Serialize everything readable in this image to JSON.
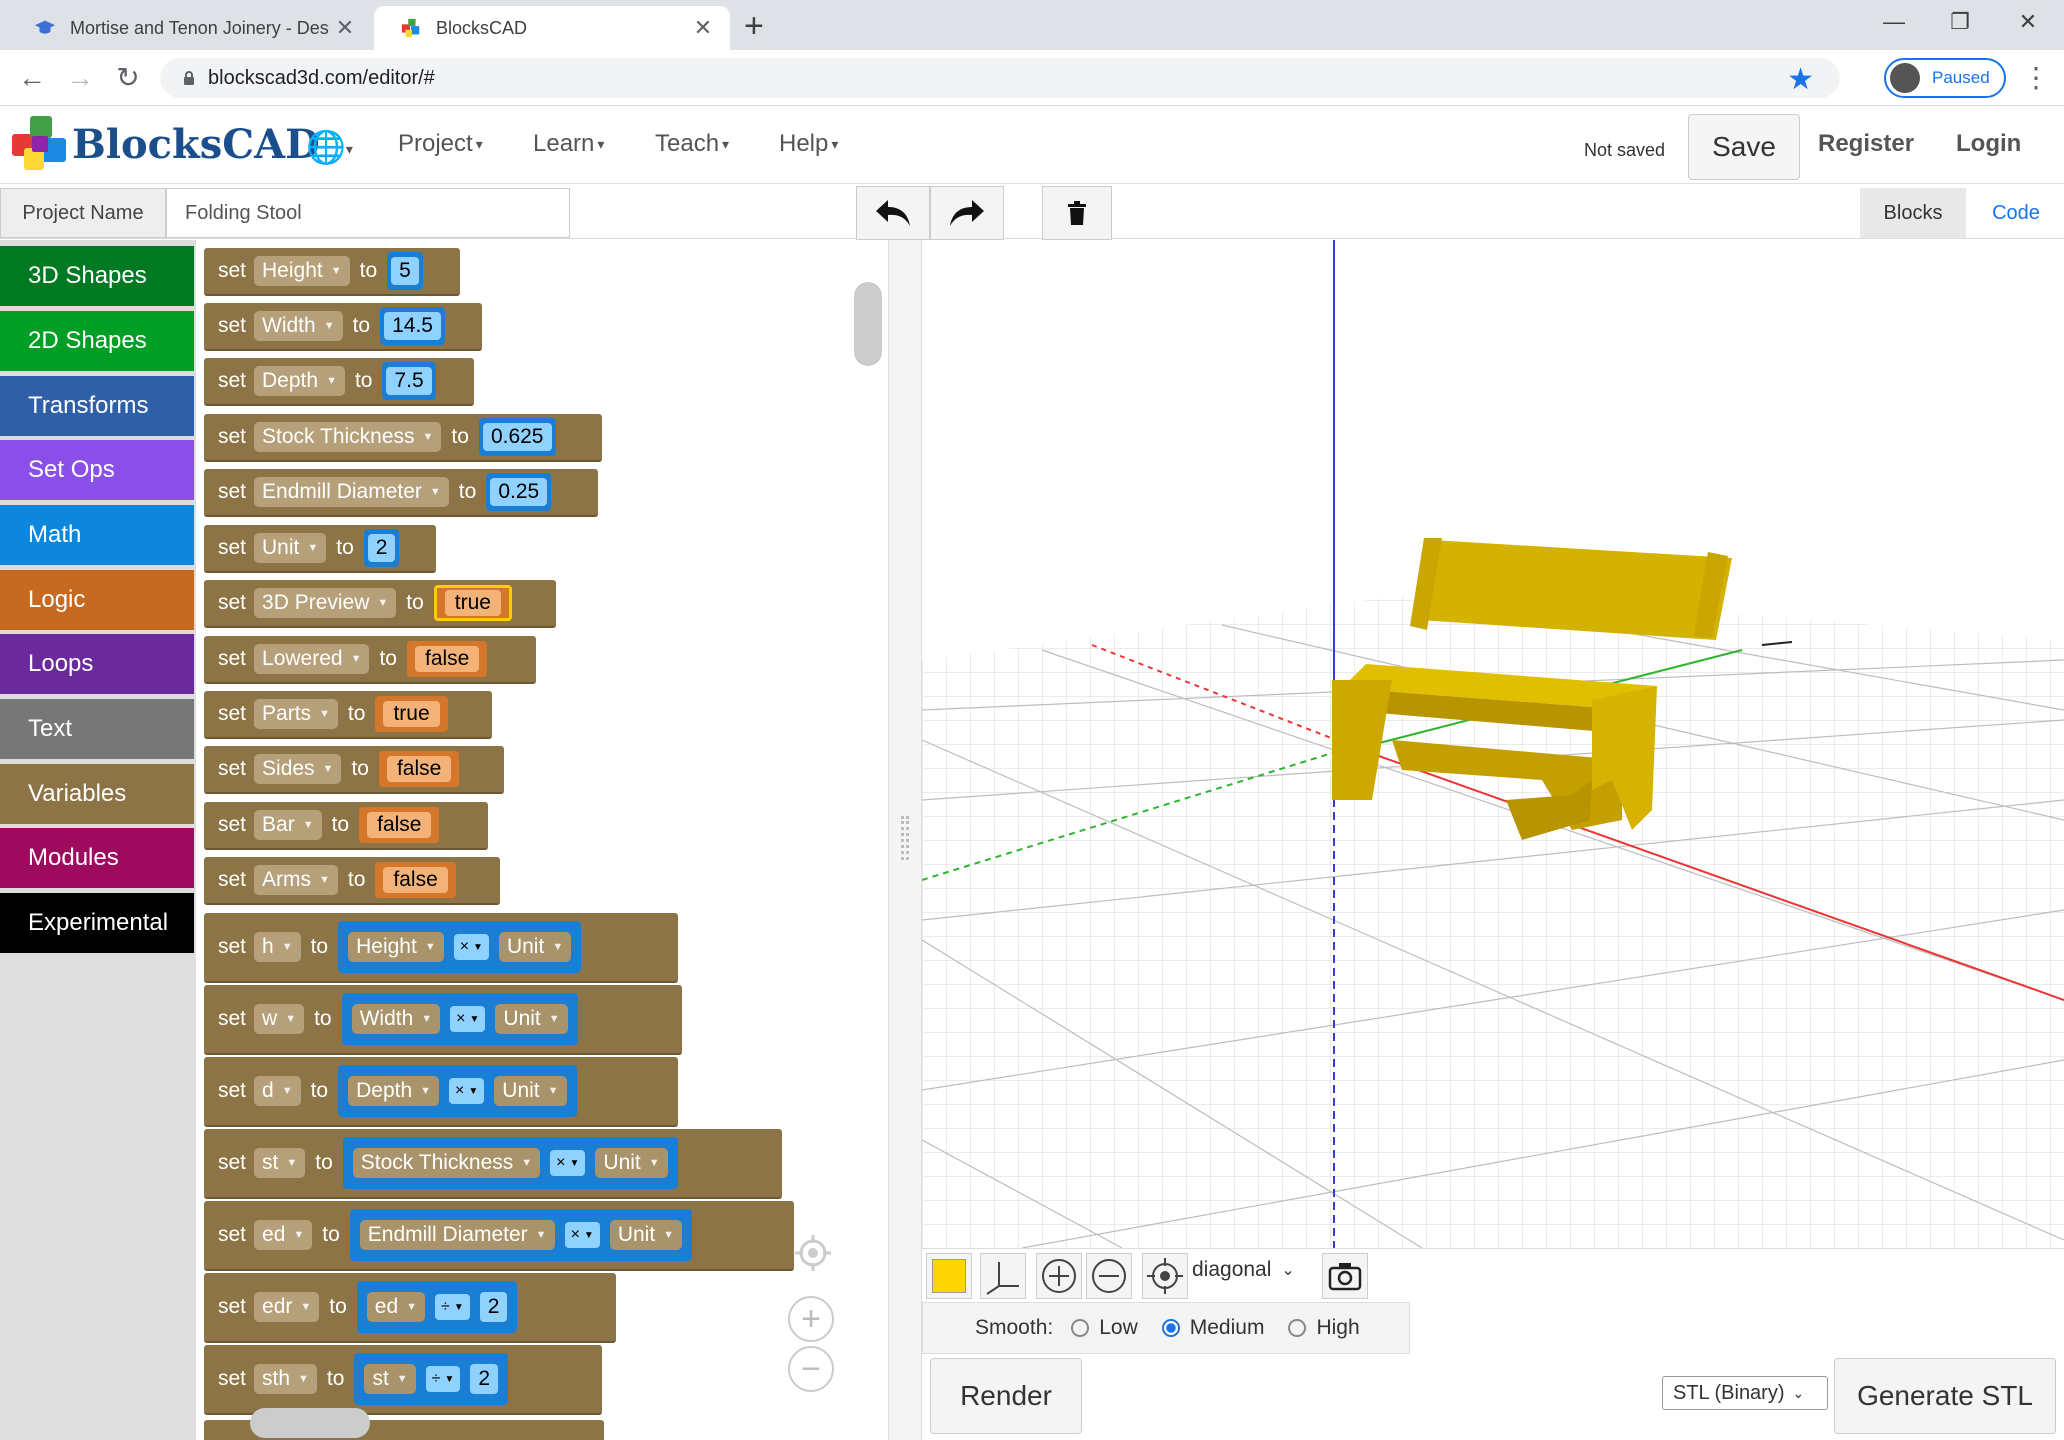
{
  "browser": {
    "tabs": [
      {
        "title": "Mortise and Tenon Joinery - Desi"
      },
      {
        "title": "BlocksCAD"
      }
    ],
    "url": "blockscad3d.com/editor/#",
    "profile_label": "Paused"
  },
  "app": {
    "logo": "BlocksCAD",
    "menu": [
      {
        "label": "Project"
      },
      {
        "label": "Learn"
      },
      {
        "label": "Teach"
      },
      {
        "label": "Help"
      }
    ],
    "status": "Not saved",
    "save_label": "Save",
    "register_label": "Register",
    "login_label": "Login",
    "project_name_label": "Project Name",
    "project_name_value": "Folding Stool",
    "view_tabs": {
      "blocks": "Blocks",
      "code": "Code"
    }
  },
  "categories": [
    {
      "label": "3D Shapes",
      "color": "#007a22"
    },
    {
      "label": "2D Shapes",
      "color": "#009e25"
    },
    {
      "label": "Transforms",
      "color": "#2f5fa7"
    },
    {
      "label": "Set Ops",
      "color": "#8a4fe8"
    },
    {
      "label": "Math",
      "color": "#0d87dc"
    },
    {
      "label": "Logic",
      "color": "#c66a22"
    },
    {
      "label": "Loops",
      "color": "#6a2a9c"
    },
    {
      "label": "Text",
      "color": "#777777"
    },
    {
      "label": "Variables",
      "color": "#8c7446"
    },
    {
      "label": "Modules",
      "color": "#9e0a5e"
    },
    {
      "label": "Experimental",
      "color": "#000000"
    }
  ],
  "blocks": {
    "set_kw": "set",
    "to_kw": "to",
    "times_op": "×",
    "divide_op": "÷",
    "simple": [
      {
        "var": "Height",
        "value": "5"
      },
      {
        "var": "Width",
        "value": "14.5"
      },
      {
        "var": "Depth",
        "value": "7.5"
      },
      {
        "var": "Stock Thickness",
        "value": "0.625"
      },
      {
        "var": "Endmill Diameter",
        "value": "0.25"
      },
      {
        "var": "Unit",
        "value": "2"
      }
    ],
    "booleans": [
      {
        "var": "3D Preview",
        "value": "true"
      },
      {
        "var": "Lowered",
        "value": "false"
      },
      {
        "var": "Parts",
        "value": "true"
      },
      {
        "var": "Sides",
        "value": "false"
      },
      {
        "var": "Bar",
        "value": "false"
      },
      {
        "var": "Arms",
        "value": "false"
      }
    ],
    "math": [
      {
        "var": "h",
        "a": "Height",
        "b": "Unit"
      },
      {
        "var": "w",
        "a": "Width",
        "b": "Unit"
      },
      {
        "var": "d",
        "a": "Depth",
        "b": "Unit"
      },
      {
        "var": "st",
        "a": "Stock Thickness",
        "b": "Unit"
      },
      {
        "var": "ed",
        "a": "Endmill Diameter",
        "b": "Unit"
      },
      {
        "var": "edr",
        "a": "ed",
        "b": "2"
      },
      {
        "var": "sth",
        "a": "st",
        "b": "2"
      }
    ]
  },
  "viewer": {
    "object_color": "#ffd700",
    "view": "diagonal",
    "smooth_label": "Smooth:",
    "smooth_options": [
      "Low",
      "Medium",
      "High"
    ],
    "smooth_selected": "Medium",
    "render_label": "Render",
    "format": "STL (Binary)",
    "generate_label": "Generate STL"
  }
}
